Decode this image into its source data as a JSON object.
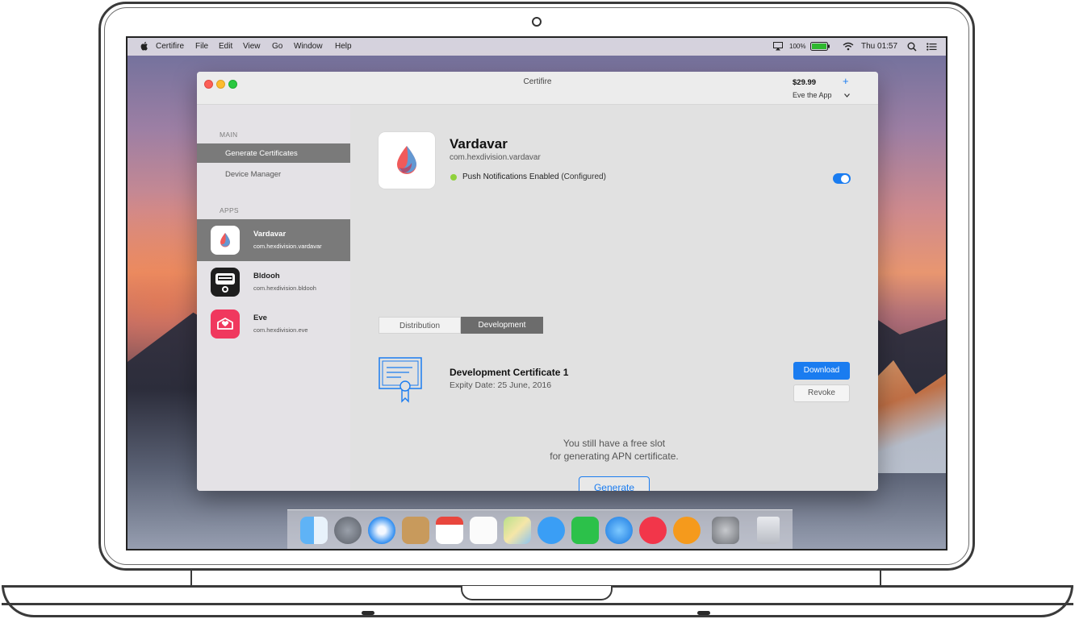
{
  "menubar": {
    "app_name": "Certifire",
    "menus": [
      "File",
      "Edit",
      "View",
      "Go",
      "Window",
      "Help"
    ],
    "battery": "100%",
    "clock": "Thu 01:57"
  },
  "window": {
    "title": "Certifire",
    "price": "$29.99",
    "account": "Eve the App",
    "add_symbol": "+",
    "chevron": "⌄"
  },
  "sidebar": {
    "main_header": "MAIN",
    "nav": [
      {
        "label": "Generate Certificates",
        "selected": true
      },
      {
        "label": "Device Manager",
        "selected": false
      }
    ],
    "apps_header": "APPS",
    "apps": [
      {
        "name": "Vardavar",
        "bundle_id": "com.hexdivision.vardavar",
        "selected": true,
        "icon": "drop-icon"
      },
      {
        "name": "Bldooh",
        "bundle_id": "com.hexdivision.bldooh",
        "selected": false,
        "icon": "bus-icon"
      },
      {
        "name": "Eve",
        "bundle_id": "com.hexdivision.eve",
        "selected": false,
        "icon": "heart-envelope-icon"
      }
    ]
  },
  "detail": {
    "app_name": "Vardavar",
    "bundle_id": "com.hexdivision.vardavar",
    "push_status_bold": "Push Notifications Enabled",
    "push_status_note": "(Configured)",
    "push_enabled": true,
    "tabs": [
      {
        "label": "Distribution",
        "active": false
      },
      {
        "label": "Development",
        "active": true
      }
    ],
    "certificate": {
      "title": "Development Certificate 1",
      "expiry": "Expity Date: 25 June, 2016",
      "download_label": "Download",
      "revoke_label": "Revoke"
    },
    "free_slot_line1": "You still have a free slot",
    "free_slot_line2": "for generating APN certificate.",
    "generate_label": "Generate"
  },
  "dock": {
    "apps": [
      "finder-icon",
      "launchpad-icon",
      "safari-icon",
      "contacts-icon",
      "calendar-icon",
      "reminders-icon",
      "maps-icon",
      "messages-icon",
      "facetime-icon",
      "app-store-icon",
      "music-icon",
      "ibooks-icon",
      "system-preferences-icon",
      "trash-icon"
    ]
  },
  "colors": {
    "accent": "#1a7cf0",
    "selected_row": "#7a7a7a",
    "status_green": "#8fd13b",
    "eve_pink": "#f0385e"
  }
}
